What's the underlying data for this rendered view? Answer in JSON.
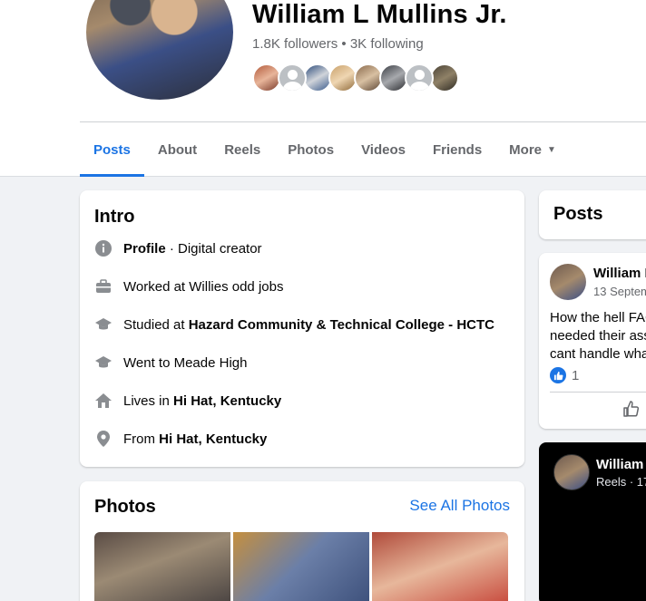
{
  "profile": {
    "name": "William L Mullins Jr.",
    "followers": "1.8K followers",
    "separator": " • ",
    "following": "3K following"
  },
  "tabs": [
    {
      "label": "Posts"
    },
    {
      "label": "About"
    },
    {
      "label": "Reels"
    },
    {
      "label": "Photos"
    },
    {
      "label": "Videos"
    },
    {
      "label": "Friends"
    },
    {
      "label": "More"
    }
  ],
  "intro": {
    "title": "Intro",
    "profile_label": "Profile",
    "profile_rest": " · Digital creator",
    "worked": "Worked at Willies odd jobs",
    "studied_prefix": "Studied at ",
    "studied_school": "Hazard Community & Technical College - HCTC",
    "went": "Went to Meade High",
    "lives_prefix": "Lives in ",
    "lives_place": "Hi Hat, Kentucky",
    "from_prefix": "From ",
    "from_place": "Hi Hat, Kentucky"
  },
  "photos": {
    "title": "Photos",
    "see_all": "See All Photos"
  },
  "posts_panel": {
    "title": "Posts",
    "post": {
      "author": "William L",
      "date": "13 Septem",
      "line1": "How the hell FAC",
      "line2": "needed their ass",
      "line3": "cant handle wha",
      "like_count": "1"
    }
  },
  "reel": {
    "author": "William",
    "meta": "Reels · 17"
  },
  "colors": {
    "accent": "#1b74e4",
    "page_bg": "#f0f2f5",
    "secondary_text": "#65676b"
  }
}
